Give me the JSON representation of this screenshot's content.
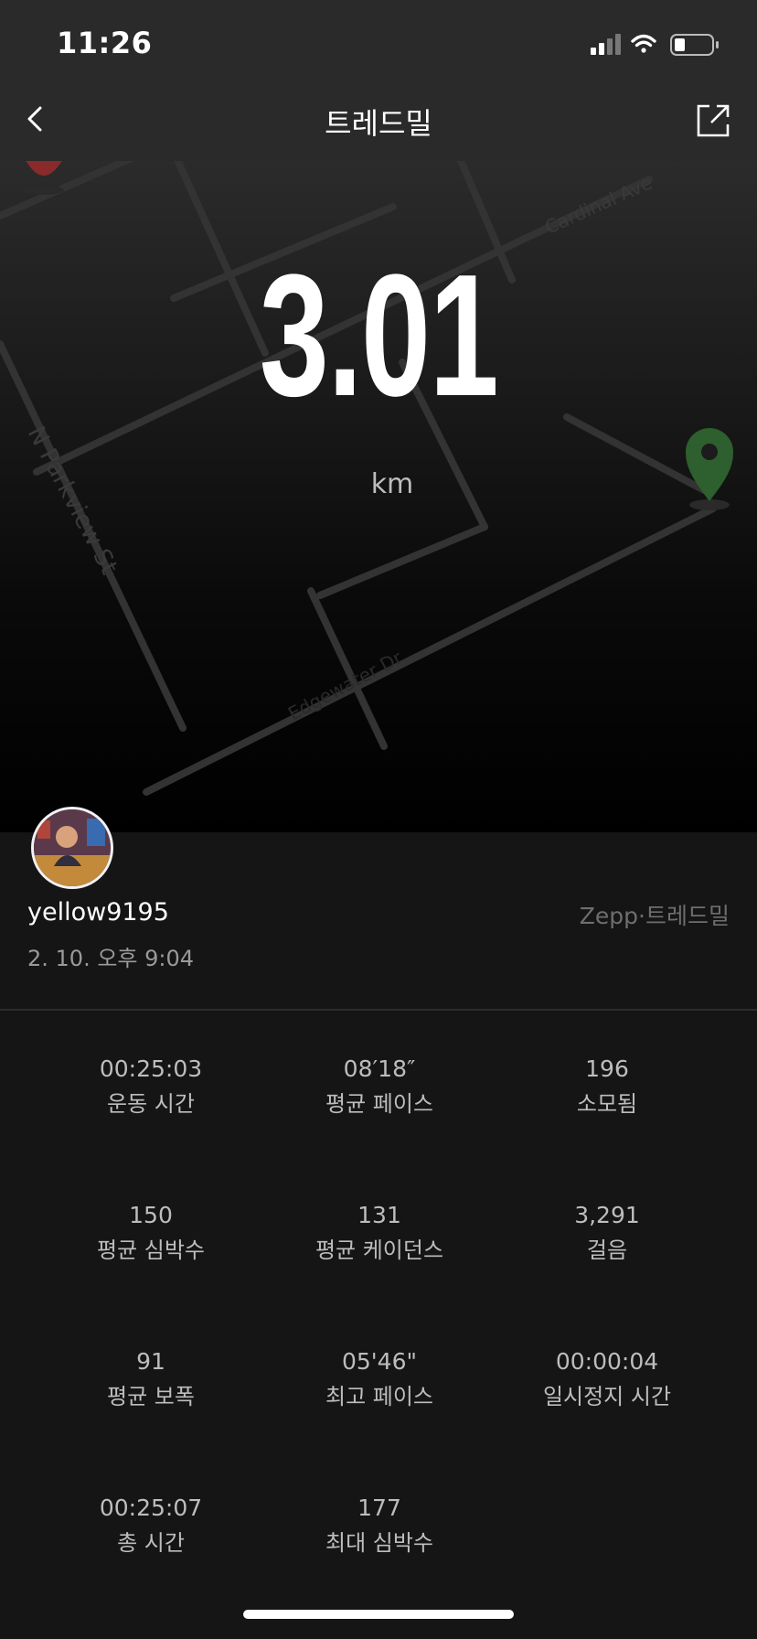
{
  "status_bar": {
    "time": "11:26"
  },
  "nav": {
    "title": "트레드밀"
  },
  "hero": {
    "distance": "3.01",
    "unit": "km"
  },
  "map": {
    "street_labels": [
      "N Parkview St",
      "Cardinal Ave",
      "Edgewater Dr"
    ]
  },
  "user": {
    "username": "yellow9195",
    "source": "Zepp·트레드밀",
    "datetime": "2. 10. 오후 9:04"
  },
  "stats": [
    {
      "value": "00:25:03",
      "label": "운동 시간"
    },
    {
      "value": "08′18″",
      "label": "평균 페이스"
    },
    {
      "value": "196",
      "label": "소모됨"
    },
    {
      "value": "150",
      "label": "평균 심박수"
    },
    {
      "value": "131",
      "label": "평균 케이던스"
    },
    {
      "value": "3,291",
      "label": "걸음"
    },
    {
      "value": "91",
      "label": "평균 보폭"
    },
    {
      "value": "05'46\"",
      "label": "최고 페이스"
    },
    {
      "value": "00:00:04",
      "label": "일시정지 시간"
    },
    {
      "value": "00:25:07",
      "label": "총 시간"
    },
    {
      "value": "177",
      "label": "최대 심박수"
    }
  ],
  "colors": {
    "background": "#151515",
    "topbar": "#2a2a2a",
    "end_marker": "#2e5f2e",
    "start_marker": "#b53535"
  }
}
